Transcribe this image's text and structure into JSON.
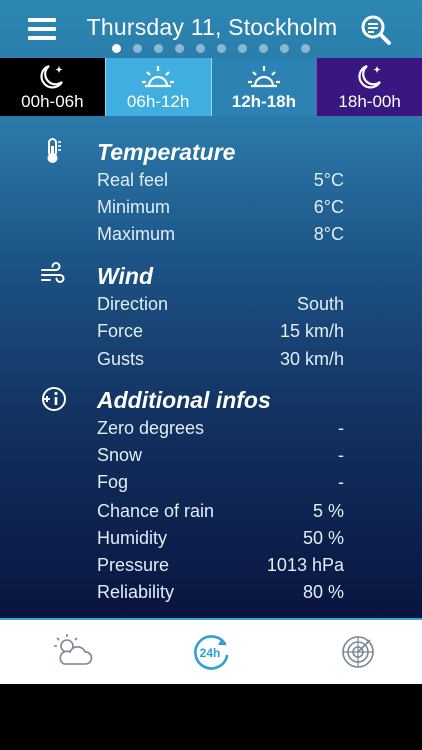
{
  "header": {
    "title": "Thursday 11, Stockholm",
    "page_count": 10,
    "active_page": 1,
    "menu_icon": "hamburger-menu-icon",
    "search_icon": "search-location-icon"
  },
  "tabs": [
    {
      "label": "00h-06h",
      "icon": "moon-icon",
      "selected": false
    },
    {
      "label": "06h-12h",
      "icon": "sunrise-icon",
      "selected": false
    },
    {
      "label": "12h-18h",
      "icon": "sun-icon",
      "selected": true
    },
    {
      "label": "18h-00h",
      "icon": "moon-icon",
      "selected": false
    }
  ],
  "temperature": {
    "title": "Temperature",
    "icon": "thermometer-icon",
    "rows": [
      {
        "label": "Real feel",
        "value": "5°C"
      },
      {
        "label": "Minimum",
        "value": "6°C"
      },
      {
        "label": "Maximum",
        "value": "8°C"
      }
    ]
  },
  "wind": {
    "title": "Wind",
    "icon": "wind-icon",
    "rows": [
      {
        "label": "Direction",
        "value": "South"
      },
      {
        "label": "Force",
        "value": "15 km/h"
      },
      {
        "label": "Gusts",
        "value": "30 km/h"
      }
    ]
  },
  "additional": {
    "title": "Additional infos",
    "icon": "info-plus-icon",
    "rows": [
      {
        "label": "Zero degrees",
        "value": "-"
      },
      {
        "label": "Snow",
        "value": "-"
      },
      {
        "label": "Fog",
        "value": "-"
      },
      {
        "label": "Chance of rain",
        "value": "5 %"
      },
      {
        "label": "Humidity",
        "value": "50 %"
      },
      {
        "label": "Pressure",
        "value": "1013 hPa"
      },
      {
        "label": "Reliability",
        "value": "80 %"
      }
    ]
  },
  "bottom_nav": {
    "items": [
      {
        "icon": "weather-cloud-sun-icon",
        "selected": false
      },
      {
        "icon": "24h-forecast-icon",
        "label": "24h",
        "selected": true
      },
      {
        "icon": "radar-icon",
        "selected": false
      }
    ]
  },
  "colors": {
    "header": "#2d87b3",
    "accent": "#3aa7d9",
    "tab_morning": "#41aee0",
    "tab_evening": "#3a1680"
  }
}
